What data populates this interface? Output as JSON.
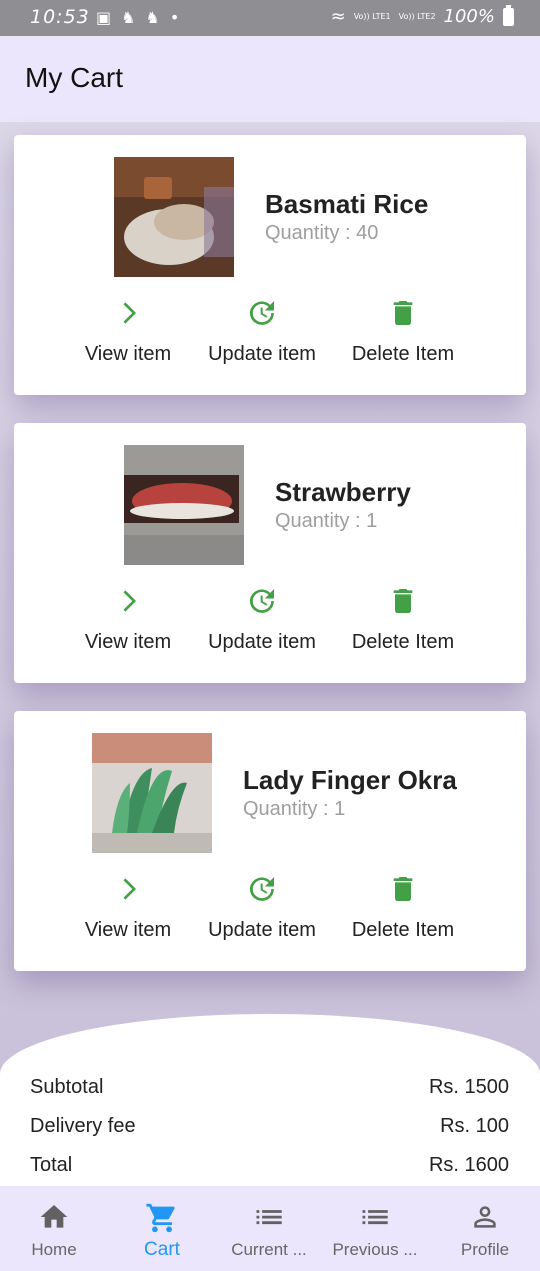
{
  "status_bar": {
    "time": "10:53",
    "battery": "100%",
    "sim1": "Vo)) LTE1",
    "sim2": "Vo)) LTE2"
  },
  "app_bar": {
    "title": "My Cart"
  },
  "cart_items": [
    {
      "name": "Basmati Rice",
      "quantity": "Quantity : 40"
    },
    {
      "name": "Strawberry",
      "quantity": "Quantity : 1"
    },
    {
      "name": "Lady Finger Okra",
      "quantity": "Quantity : 1"
    }
  ],
  "actions": {
    "view": "View item",
    "update": "Update item",
    "delete": "Delete Item"
  },
  "summary": {
    "subtotal_label": "Subtotal",
    "subtotal_value": "Rs. 1500",
    "delivery_label": "Delivery fee",
    "delivery_value": "Rs. 100",
    "total_label": "Total",
    "total_value": "Rs. 1600"
  },
  "bottom_nav": [
    {
      "label": "Home",
      "icon": "home-icon"
    },
    {
      "label": "Cart",
      "icon": "cart-icon"
    },
    {
      "label": "Current ...",
      "icon": "list-icon"
    },
    {
      "label": "Previous ...",
      "icon": "list-icon"
    },
    {
      "label": "Profile",
      "icon": "person-icon"
    }
  ],
  "colors": {
    "accent_green": "#43a047",
    "active_blue": "#2196f3",
    "appbar_bg": "#ece6fc"
  }
}
